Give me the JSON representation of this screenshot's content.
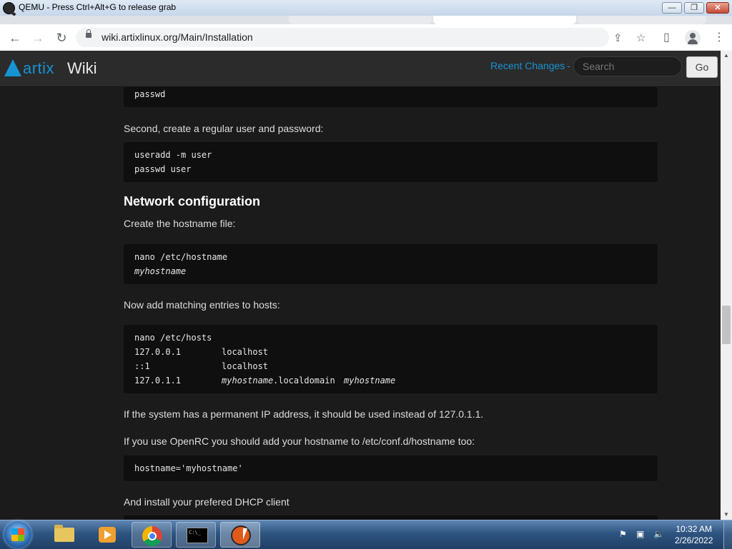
{
  "qemu": {
    "title": "QEMU - Press Ctrl+Alt+G to release grab",
    "min": "—",
    "max": "❐",
    "close": "✕"
  },
  "browser": {
    "url": "wiki.artixlinux.org/Main/Installation",
    "back": "←",
    "forward": "→",
    "reload": "↻",
    "share": "⇪",
    "star": "☆",
    "sidepanel": "▯",
    "menu": "⋮"
  },
  "wiki": {
    "logo": "artix",
    "logo_suffix": "Wiki",
    "recent_changes": "Recent Changes",
    "separator": "-",
    "search_placeholder": "Search",
    "go": "Go"
  },
  "content": {
    "code_passwd": "passwd",
    "para_regular_user": "Second, create a regular user and password:",
    "code_useradd": [
      "useradd -m user",
      "passwd user"
    ],
    "heading_network": "Network configuration",
    "para_hostname_file": "Create the hostname file:",
    "code_hostname": {
      "cmd": "nano /etc/hostname",
      "value": "myhostname"
    },
    "para_hosts": "Now add matching entries to hosts:",
    "code_hosts": {
      "cmd": "nano /etc/hosts",
      "rows": [
        {
          "ip": "127.0.0.1",
          "name": "localhost"
        },
        {
          "ip": "::1",
          "name": "localhost"
        },
        {
          "ip": "127.0.1.1",
          "name_italic": "myhostname",
          "name_mid": ".localdomain",
          "name_italic2": "myhostname"
        }
      ]
    },
    "para_permanent_ip": "If the system has a permanent IP address, it should be used instead of 127.0.1.1.",
    "para_openrc": "If you use OpenRC you should add your hostname to /etc/conf.d/hostname too:",
    "code_openrc": "hostname='myhostname'",
    "para_dhcp": "And install your prefered DHCP client"
  },
  "taskbar": {
    "items": [
      "windows-explorer",
      "media-player",
      "google-chrome",
      "command-prompt",
      "qemu"
    ],
    "time": "10:32 AM",
    "date": "2/26/2022"
  },
  "colors": {
    "accent": "#1793d1",
    "background": "#1b1b1b",
    "code_bg": "#0f0f0f",
    "header_bg": "#2b2b2b"
  }
}
